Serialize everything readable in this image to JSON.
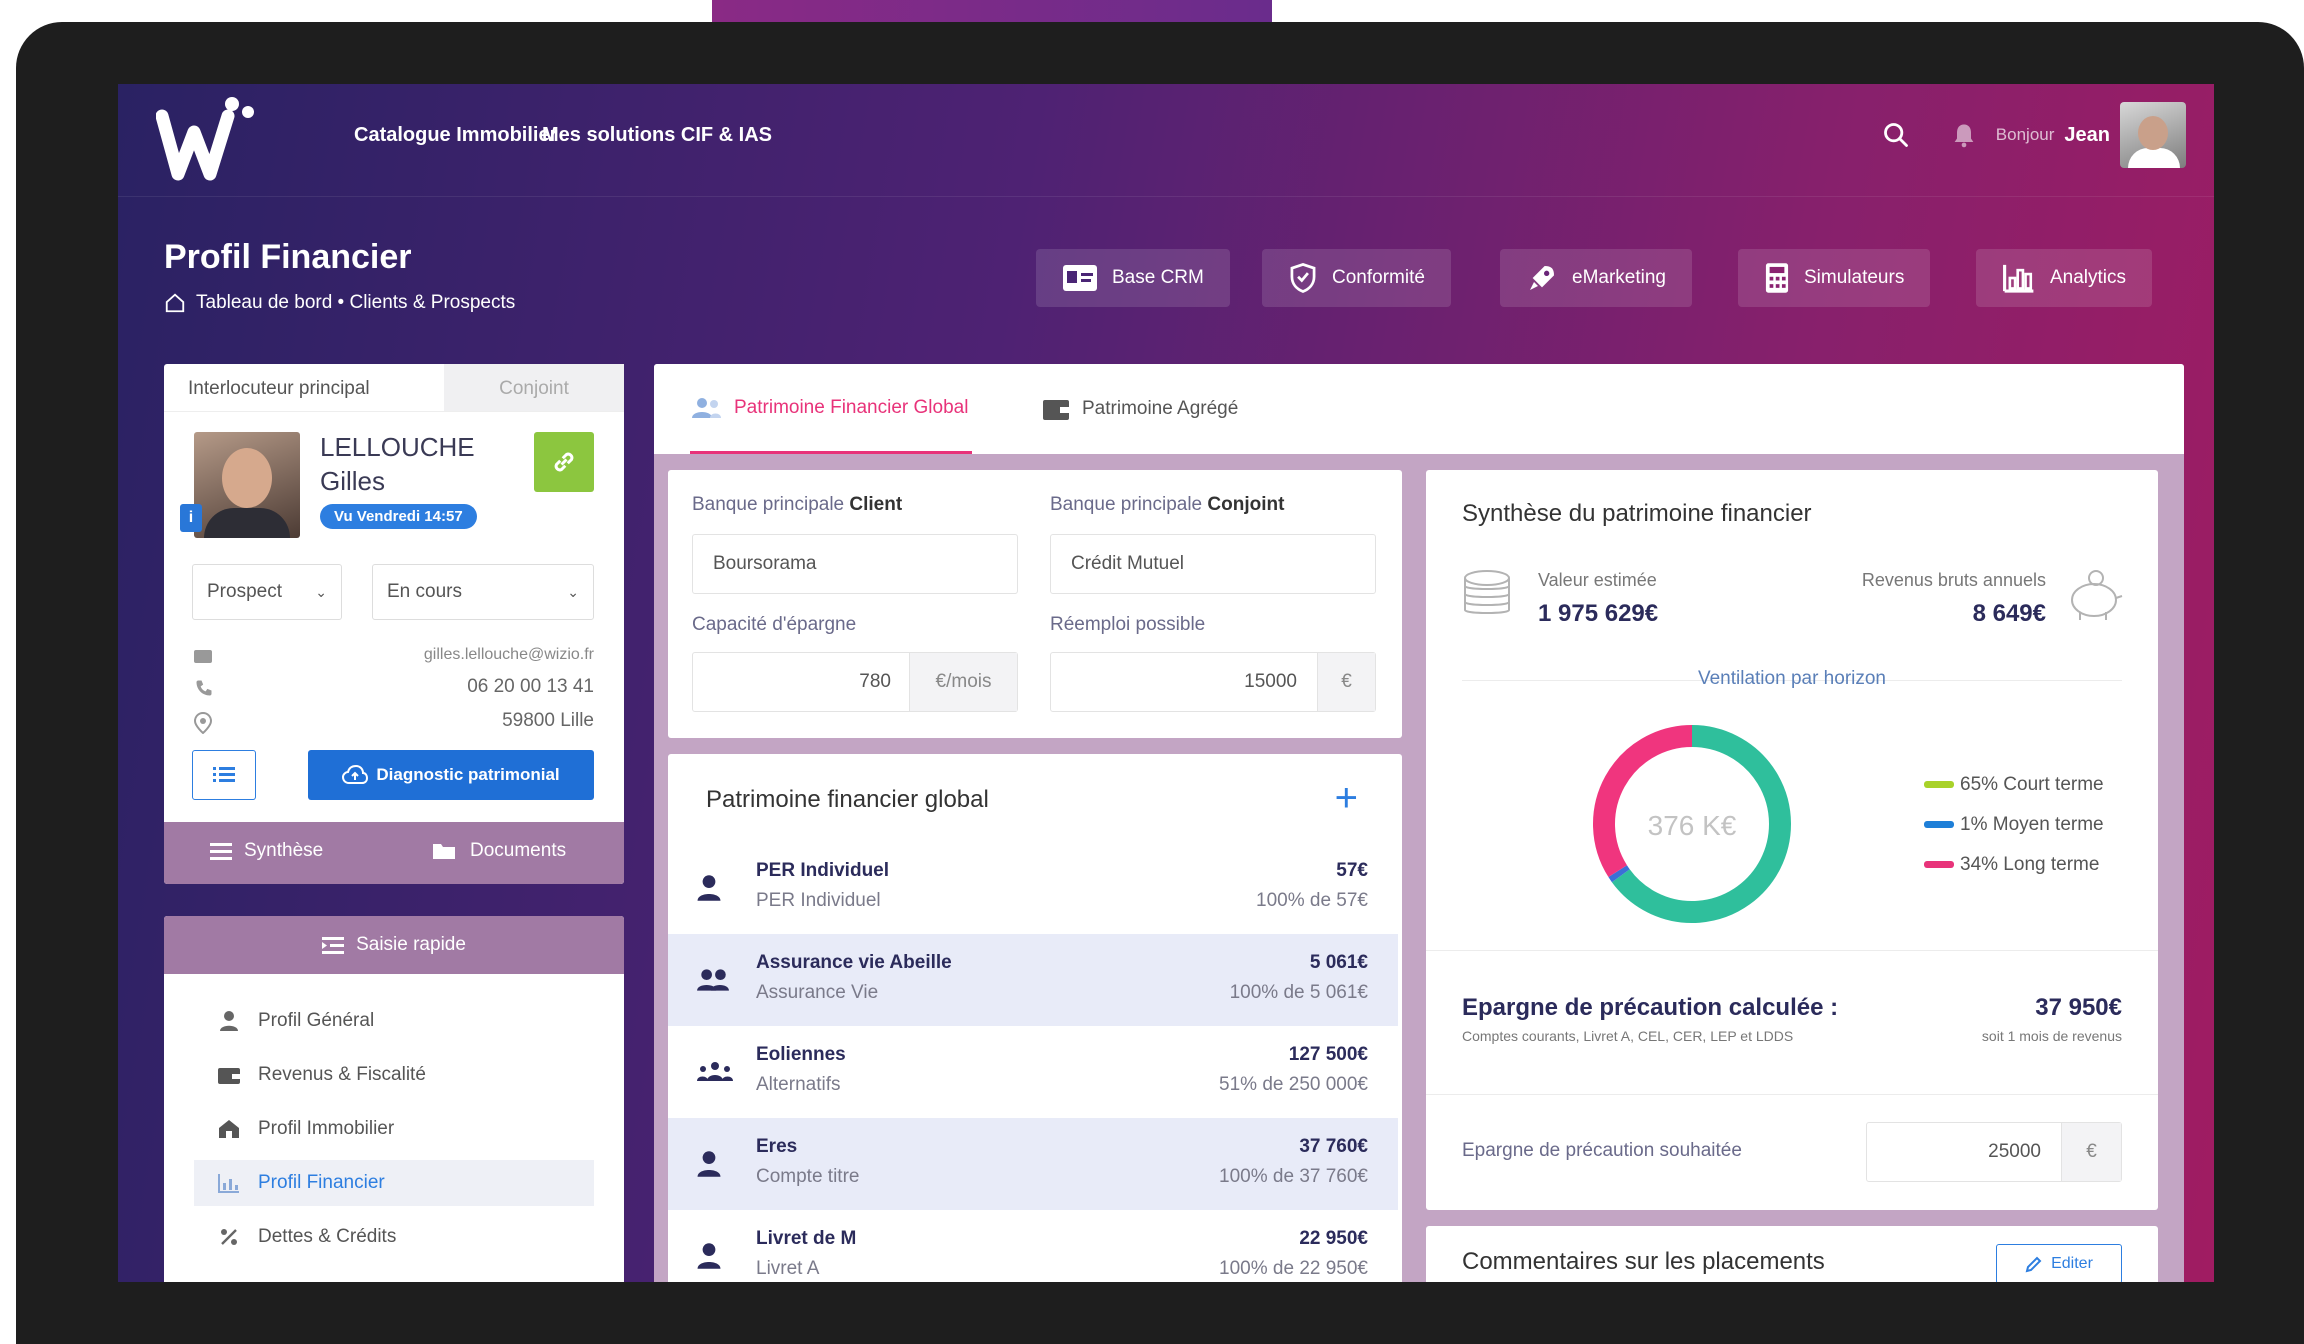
{
  "nav": {
    "link_catalogue": "Catalogue Immobilier",
    "link_solutions": "Mes solutions CIF & IAS",
    "greeting": "Bonjour",
    "user_name": "Jean"
  },
  "header": {
    "title": "Profil Financier",
    "breadcrumb": "Tableau de bord • Clients & Prospects",
    "modules": [
      "Base CRM",
      "Conformité",
      "eMarketing",
      "Simulateurs",
      "Analytics"
    ]
  },
  "client_card": {
    "tab_main": "Interlocuteur principal",
    "tab_spouse": "Conjoint",
    "last_name": "LELLOUCHE",
    "first_name": "Gilles",
    "seen_badge": "Vu Vendredi 14:57",
    "status": "Prospect",
    "progress": "En cours",
    "email": "gilles.lellouche@wizio.fr",
    "phone": "06 20 00 13 41",
    "location": "59800 Lille",
    "diag_button": "Diagnostic patrimonial",
    "footer_synthese": "Synthèse",
    "footer_documents": "Documents"
  },
  "quick": {
    "title": "Saisie rapide",
    "items": [
      "Profil Général",
      "Revenus & Fiscalité",
      "Profil Immobilier",
      "Profil Financier",
      "Dettes & Crédits"
    ]
  },
  "main_tabs": [
    "Patrimoine Financier Global",
    "Patrimoine Agrégé"
  ],
  "banks": {
    "client_label_prefix": "Banque principale",
    "client_label_strong": "Client",
    "conjoint_label_prefix": "Banque principale",
    "conjoint_label_strong": "Conjoint",
    "client_value": "Boursorama",
    "conjoint_value": "Crédit Mutuel",
    "capacity_label": "Capacité d'épargne",
    "capacity_value": "780",
    "capacity_unit": "€/mois",
    "reuse_label": "Réemploi possible",
    "reuse_value": "15000",
    "reuse_unit": "€"
  },
  "patrimoine": {
    "title": "Patrimoine financier global",
    "rows": [
      {
        "name": "PER Individuel",
        "type": "PER Individuel",
        "amount": "57€",
        "share": "100% de 57€"
      },
      {
        "name": "Assurance vie Abeille",
        "type": "Assurance Vie",
        "amount": "5 061€",
        "share": "100% de 5 061€"
      },
      {
        "name": "Eoliennes",
        "type": "Alternatifs",
        "amount": "127 500€",
        "share": "51% de 250 000€"
      },
      {
        "name": "Eres",
        "type": "Compte titre",
        "amount": "37 760€",
        "share": "100% de 37 760€"
      },
      {
        "name": "Livret de M",
        "type": "Livret A",
        "amount": "22 950€",
        "share": "100% de 22 950€"
      }
    ]
  },
  "synthese": {
    "title": "Synthèse du patrimoine financier",
    "value_label": "Valeur estimée",
    "value": "1 975 629€",
    "income_label": "Revenus bruts annuels",
    "income": "8 649€",
    "ventilation": "Ventilation par horizon",
    "donut_center": "376 K€",
    "legend": [
      {
        "label": "65% Court terme",
        "color": "#a8d22a"
      },
      {
        "label": "1% Moyen terme",
        "color": "#1e7fd8"
      },
      {
        "label": "34% Long terme",
        "color": "#e8337a"
      }
    ],
    "precaution_title": "Epargne de précaution calculée :",
    "precaution_sub": "Comptes courants, Livret A, CEL, CER, LEP et LDDS",
    "precaution_value": "37 950€",
    "precaution_note": "soit 1 mois de revenus",
    "wished_label": "Epargne de précaution souhaitée",
    "wished_value": "25000",
    "wished_unit": "€",
    "comments_title": "Commentaires sur les placements",
    "edit_button": "Editer"
  },
  "chart_data": {
    "type": "pie",
    "categories": [
      "Court terme",
      "Moyen terme",
      "Long terme"
    ],
    "values": [
      65,
      1,
      34
    ],
    "colors": [
      "#2fbf9c",
      "#3b6fd6",
      "#f0357e"
    ]
  }
}
